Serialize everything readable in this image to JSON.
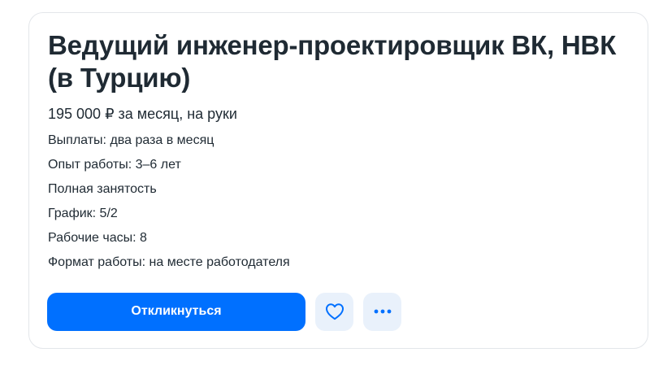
{
  "vacancy": {
    "title": "Ведущий инженер-проектировщик ВК, НВК (в Турцию)",
    "salary": "195 000 ₽ за месяц, на руки",
    "details": [
      "Выплаты: два раза в месяц",
      "Опыт работы: 3–6 лет",
      "Полная занятость",
      "График: 5/2",
      "Рабочие часы: 8",
      "Формат работы: на месте работодателя"
    ]
  },
  "actions": {
    "apply_label": "Откликнуться",
    "favorite_icon": "heart-icon",
    "more_icon": "more-horizontal-icon"
  },
  "colors": {
    "primary": "#0070ff",
    "icon_button_bg": "#e9f1fb",
    "text": "#1f2a33",
    "border": "#e3e6ea"
  }
}
